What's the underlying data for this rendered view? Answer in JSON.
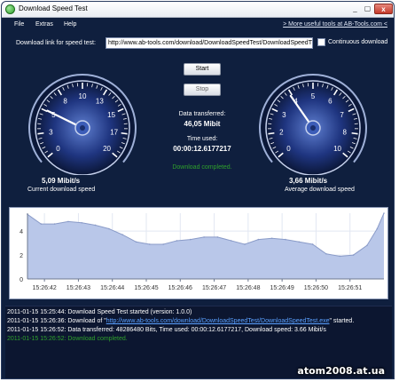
{
  "window": {
    "title": "Download Speed Test",
    "more_link": "> More useful tools at AB-Tools.com <"
  },
  "menu": [
    "File",
    "Extras",
    "Help"
  ],
  "controls": {
    "url_label": "Download link for speed test:",
    "url_value": "http://www.ab-tools.com/download/DownloadSpeedTest/DownloadSpeedT",
    "continuous_label": "Continuous download",
    "continuous_checked": false,
    "start_label": "Start",
    "stop_label": "Stop"
  },
  "stats": {
    "data_label": "Data transferred:",
    "data_value": "46,05 Mibit",
    "time_label": "Time used:",
    "time_value": "00:00:12.6177217",
    "status": "Download completed.",
    "status_color": "#2fa12c"
  },
  "gauges": {
    "current": {
      "ticks": [
        "0",
        "3",
        "5",
        "8",
        "10",
        "13",
        "15",
        "17",
        "20"
      ],
      "value": 5.09,
      "max": 20,
      "display": "5,09 Mibit/s",
      "caption": "Current download speed"
    },
    "average": {
      "ticks": [
        "0",
        "2",
        "3",
        "4",
        "5",
        "6",
        "7",
        "8",
        "10"
      ],
      "value": 3.66,
      "max": 10,
      "display": "3,66 Mibit/s",
      "caption": "Average download speed"
    }
  },
  "chart_data": {
    "type": "area",
    "x_ticks": [
      "15:26:42",
      "15:26:43",
      "15:26:44",
      "15:26:45",
      "15:26:46",
      "15:26:47",
      "15:26:48",
      "15:26:49",
      "15:26:50",
      "15:26:51"
    ],
    "y_ticks": [
      "0",
      "2",
      "4"
    ],
    "ylim": [
      0,
      5.5
    ],
    "x_range": [
      0,
      10.5
    ],
    "x": [
      0,
      0.4,
      0.8,
      1.2,
      1.6,
      2.0,
      2.4,
      2.8,
      3.2,
      3.6,
      4.0,
      4.4,
      4.8,
      5.2,
      5.6,
      6.0,
      6.4,
      6.8,
      7.2,
      7.6,
      8.0,
      8.4,
      8.8,
      9.2,
      9.6,
      10.0,
      10.3,
      10.5
    ],
    "y": [
      5.4,
      4.6,
      4.6,
      4.8,
      4.7,
      4.5,
      4.2,
      3.7,
      3.1,
      2.9,
      2.9,
      3.2,
      3.3,
      3.5,
      3.5,
      3.2,
      2.9,
      3.3,
      3.4,
      3.3,
      3.1,
      2.9,
      2.1,
      1.9,
      2.0,
      2.8,
      4.2,
      5.5
    ],
    "fill_color": "#b9c7e9",
    "line_color": "#8a9bc8"
  },
  "log": [
    {
      "text": "2011-01-15 15:25:44: Download Speed Test started (version: 1.0.0)"
    },
    {
      "prefix": "2011-01-15 15:26:36: Download of \"",
      "link": "http://www.ab-tools.com/download/DownloadSpeedTest/DownloadSpeedTest.exe",
      "suffix": "\" started."
    },
    {
      "text": "2011-01-15 15:26:52: Data transferred: 48286480 Bits, Time used: 00:00:12.6177217, Download speed: 3.66 Mibit/s"
    },
    {
      "text": "2011-01-15 15:26:52: Download completed.",
      "color": "#2fa12c"
    }
  ],
  "watermark": "atom2008.at.ua"
}
